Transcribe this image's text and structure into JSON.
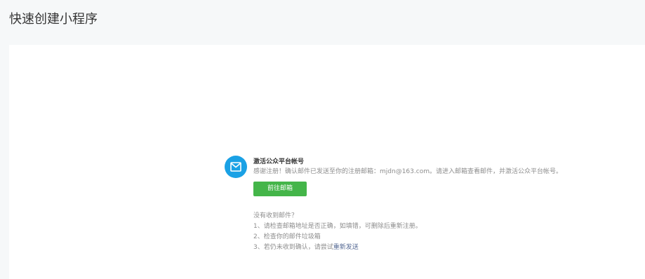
{
  "page": {
    "title": "快速创建小程序"
  },
  "notice": {
    "icon": "mail-icon",
    "title": "激活公众平台帐号",
    "description_prefix": "感谢注册！确认邮件已发送至你的注册邮箱：",
    "email": "mjdn@163.com",
    "description_suffix": "。请进入邮箱查看邮件，并激活公众平台帐号。",
    "button_label": "前往邮箱"
  },
  "help": {
    "heading": "没有收到邮件？",
    "item1": "1、请检查邮箱地址是否正确，如填错，可删除后重新注册。",
    "item2": "2、检查你的邮件垃圾箱",
    "item3_prefix": "3、若仍未收到确认，请尝试",
    "resend_label": "重新发送"
  },
  "colors": {
    "background": "#f6f8f9",
    "panel": "#ffffff",
    "icon_circle": "#1aa1e5",
    "button": "#44b549",
    "link": "#576b95"
  }
}
